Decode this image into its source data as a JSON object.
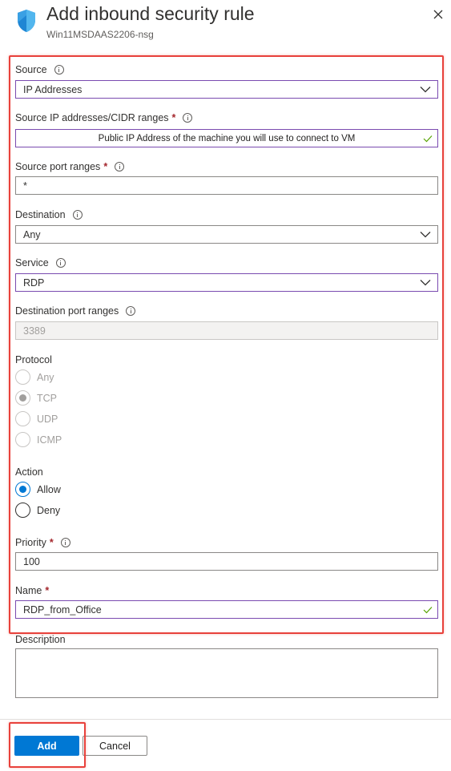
{
  "header": {
    "title": "Add inbound security rule",
    "subtitle": "Win11MSDAAS2206-nsg"
  },
  "source": {
    "label": "Source",
    "value": "IP Addresses"
  },
  "source_ip": {
    "label": "Source IP addresses/CIDR ranges",
    "required": "*",
    "value": "Public IP Address of the machine you will use to connect to VM"
  },
  "source_port": {
    "label": "Source port ranges",
    "required": "*",
    "value": "*"
  },
  "destination": {
    "label": "Destination",
    "value": "Any"
  },
  "service": {
    "label": "Service",
    "value": "RDP"
  },
  "dest_port": {
    "label": "Destination port ranges",
    "value": "3389"
  },
  "protocol": {
    "label": "Protocol",
    "options": [
      "Any",
      "TCP",
      "UDP",
      "ICMP"
    ],
    "selected": "TCP"
  },
  "action": {
    "label": "Action",
    "options": [
      "Allow",
      "Deny"
    ],
    "selected": "Allow"
  },
  "priority": {
    "label": "Priority",
    "required": "*",
    "value": "100"
  },
  "name": {
    "label": "Name",
    "required": "*",
    "value": "RDP_from_Office"
  },
  "description": {
    "label": "Description",
    "value": ""
  },
  "buttons": {
    "add": "Add",
    "cancel": "Cancel"
  },
  "colors": {
    "accent": "#0078d4",
    "highlight": "#e8413b",
    "focus": "#7a4bb0",
    "valid": "#57a300"
  },
  "icons": [
    "shield-icon",
    "close-icon",
    "info-icon",
    "chevron-down-icon",
    "checkmark-icon"
  ]
}
